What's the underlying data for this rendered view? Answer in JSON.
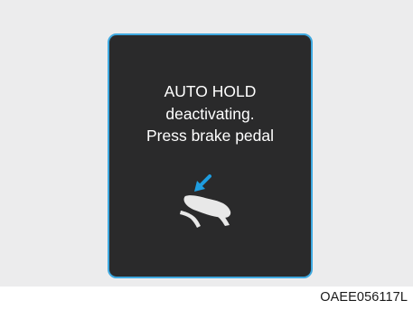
{
  "display": {
    "border_color": "#3fa9e0",
    "background_color": "#2a2a2b",
    "message_lines": [
      "AUTO HOLD",
      "deactivating.",
      "Press brake pedal"
    ],
    "icon": "brake-pedal-press-icon",
    "arrow_color": "#1e9de0"
  },
  "caption": "OAEE056117L"
}
